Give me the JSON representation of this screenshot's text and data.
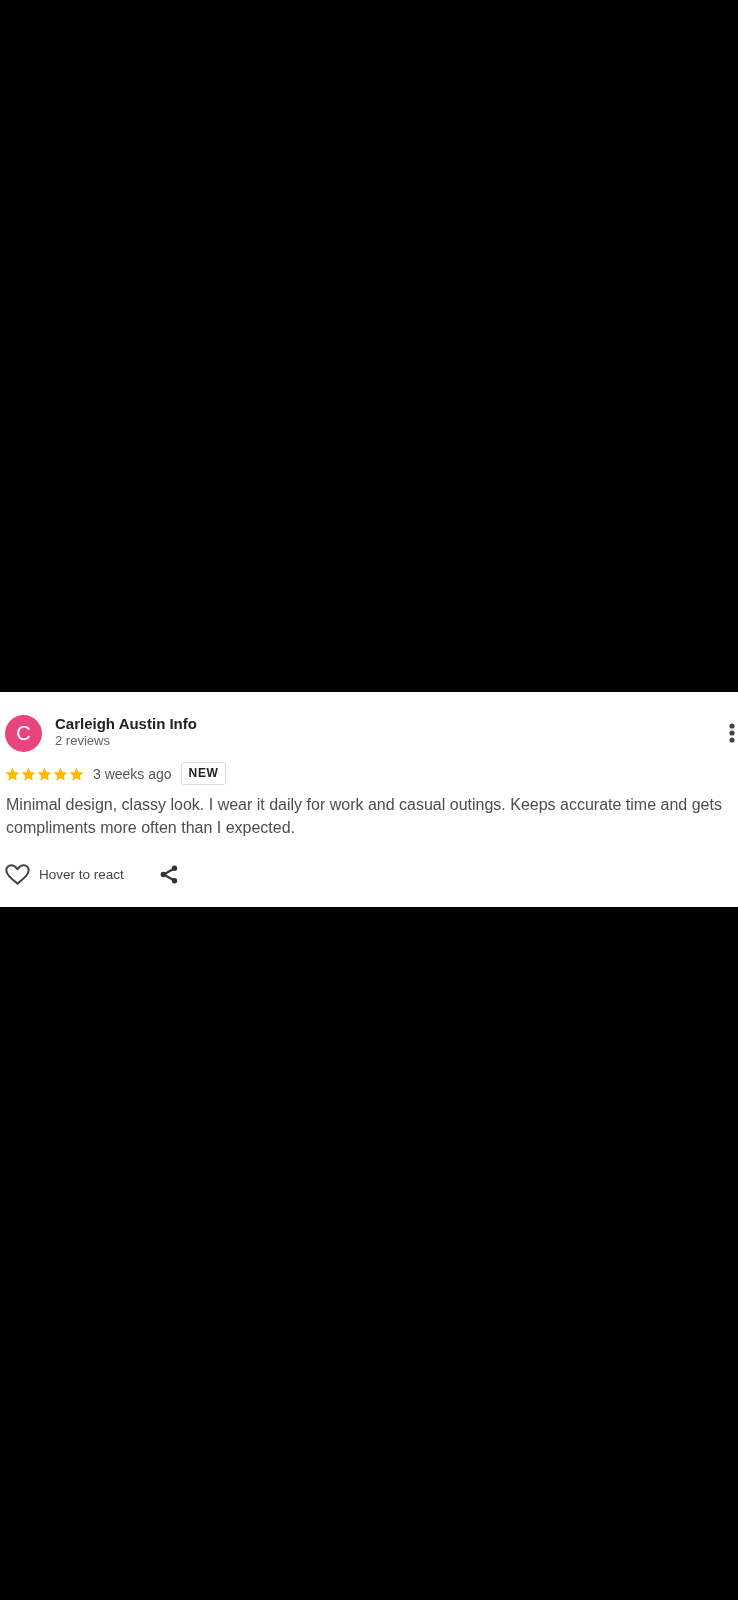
{
  "review": {
    "author": {
      "initial": "C",
      "name": "Carleigh Austin Info",
      "reviews": "2 reviews"
    },
    "stars": 5,
    "time": "3 weeks ago",
    "badge": "NEW",
    "text": "Minimal design, classy look. I wear it daily for work and casual outings. Keeps accurate time and gets compliments more often than I expected.",
    "actions": {
      "react_label": "Hover to react"
    }
  }
}
